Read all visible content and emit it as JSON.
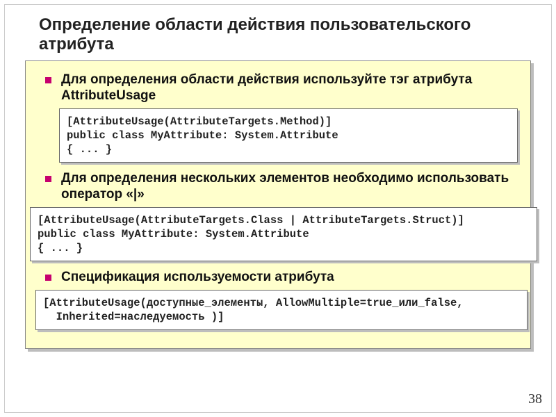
{
  "title": "Определение области действия пользовательского атрибута",
  "bullets": {
    "b1": "Для определения области действия используйте тэг атрибута AttributeUsage",
    "b2": "Для определения нескольких элементов необходимо использовать оператор «|»",
    "b3": "Спецификация используемости атрибута"
  },
  "code": {
    "c1": "[AttributeUsage(AttributeTargets.Method)]\npublic class MyAttribute: System.Attribute\n{ ... }",
    "c2": "[AttributeUsage(AttributeTargets.Class | AttributeTargets.Struct)]\npublic class MyAttribute: System.Attribute\n{ ... }",
    "c3": "[AttributeUsage(доступные_элементы, AllowMultiple=true_или_false,\n  Inherited=наследуемость )]"
  },
  "pagenum": "38"
}
